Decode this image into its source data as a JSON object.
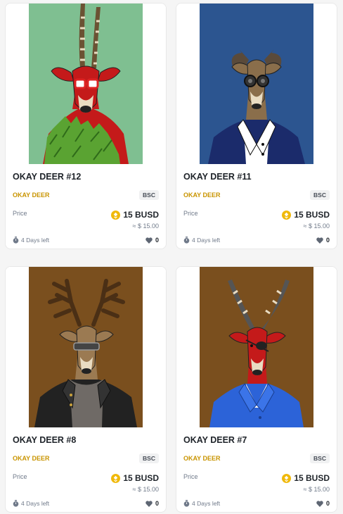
{
  "colors": {
    "accent_gold": "#c99400",
    "coin_yellow": "#f0b90b",
    "text_primary": "#1e2329",
    "text_secondary": "#707a8a"
  },
  "cards": [
    {
      "name": "OKAY DEER #12",
      "collection": "OKAY DEER",
      "chain": "BSC",
      "price_label": "Price",
      "price": "15 BUSD",
      "usd": "≈ $ 15.00",
      "time_left": "4 Days left",
      "likes": "0",
      "art": {
        "background": "#7fbf91",
        "fur": "#c41a1a",
        "horns": "long-straight",
        "accessory": "red ski goggles",
        "top": "green leafy garment"
      }
    },
    {
      "name": "OKAY DEER #11",
      "collection": "OKAY DEER",
      "chain": "BSC",
      "price_label": "Price",
      "price": "15 BUSD",
      "usd": "≈ $ 15.00",
      "time_left": "4 Days left",
      "likes": "0",
      "art": {
        "background": "#2c5590",
        "fur": "#8a6e4b",
        "horns": "curved",
        "accessory": "round dark glasses",
        "top": "navy suit with white shirt"
      }
    },
    {
      "name": "OKAY DEER #8",
      "collection": "OKAY DEER",
      "chain": "BSC",
      "price_label": "Price",
      "price": "15 BUSD",
      "usd": "≈ $ 15.00",
      "time_left": "4 Days left",
      "likes": "0",
      "art": {
        "background": "#7a4f1e",
        "fur": "#9b7a52",
        "horns": "branched antlers",
        "accessory": "visor glasses",
        "top": "black jacket"
      }
    },
    {
      "name": "OKAY DEER #7",
      "collection": "OKAY DEER",
      "chain": "BSC",
      "price_label": "Price",
      "price": "15 BUSD",
      "usd": "≈ $ 15.00",
      "time_left": "4 Days left",
      "likes": "0",
      "art": {
        "background": "#7a4f1e",
        "fur": "#c41a1a",
        "horns": "long-ringed",
        "accessory": "eye patch",
        "top": "blue suit"
      }
    }
  ]
}
